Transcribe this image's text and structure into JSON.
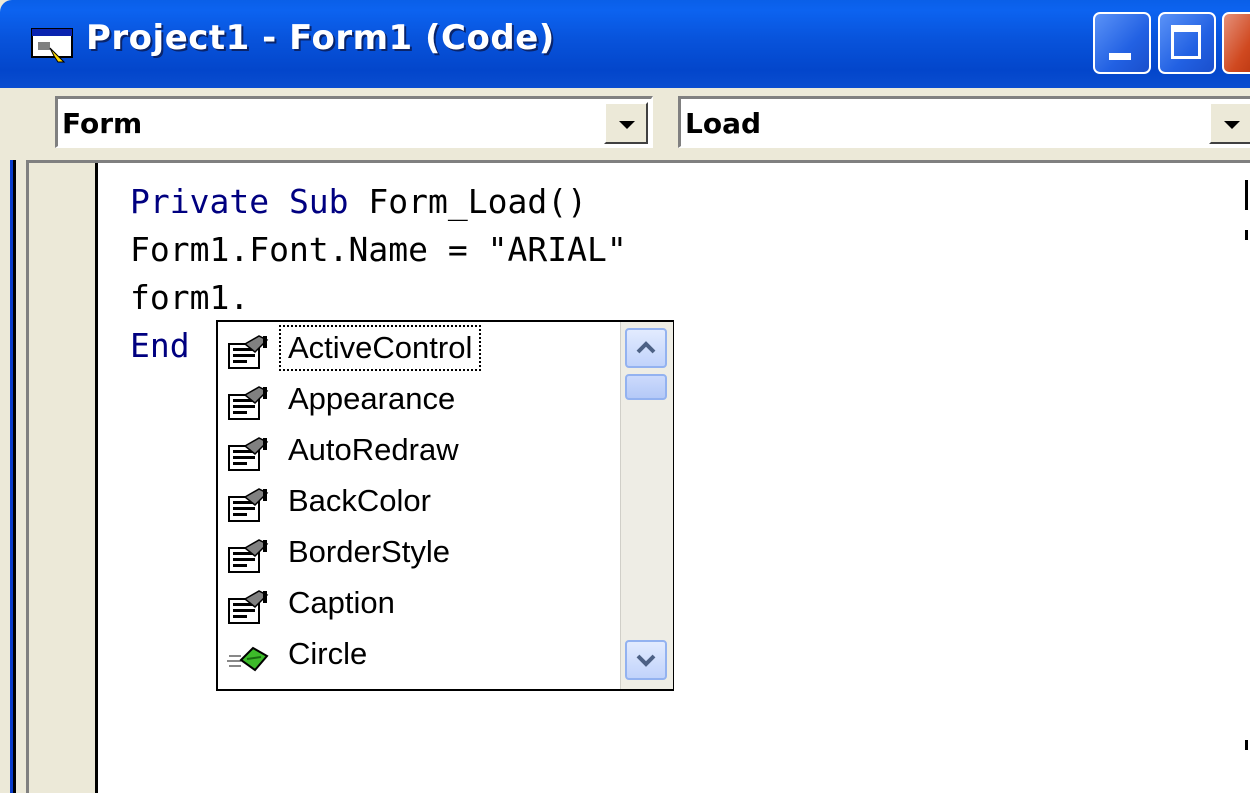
{
  "window": {
    "title": "Project1 - Form1 (Code)",
    "icon": "vb-form-icon",
    "controls": [
      "minimize-icon",
      "maximize-icon",
      "close-icon"
    ]
  },
  "toolbar": {
    "object_combo": {
      "value": "Form"
    },
    "procedure_combo": {
      "value": "Load"
    }
  },
  "code": {
    "line1_keyword": "Private Sub",
    "line1_rest": " Form_Load()",
    "line2": "Form1.Font.Name = \"ARIAL\"",
    "line3": "form1.",
    "line4_keyword": "End"
  },
  "autocomplete": {
    "items": [
      {
        "label": "ActiveControl",
        "icon": "property-icon",
        "selected": true
      },
      {
        "label": "Appearance",
        "icon": "property-icon"
      },
      {
        "label": "AutoRedraw",
        "icon": "property-icon"
      },
      {
        "label": "BackColor",
        "icon": "property-icon"
      },
      {
        "label": "BorderStyle",
        "icon": "property-icon"
      },
      {
        "label": "Caption",
        "icon": "property-icon"
      },
      {
        "label": "Circle",
        "icon": "method-icon"
      }
    ]
  },
  "colors": {
    "titlebar": "#0853DB",
    "keyword": "#000080",
    "face": "#ECE9D8"
  }
}
